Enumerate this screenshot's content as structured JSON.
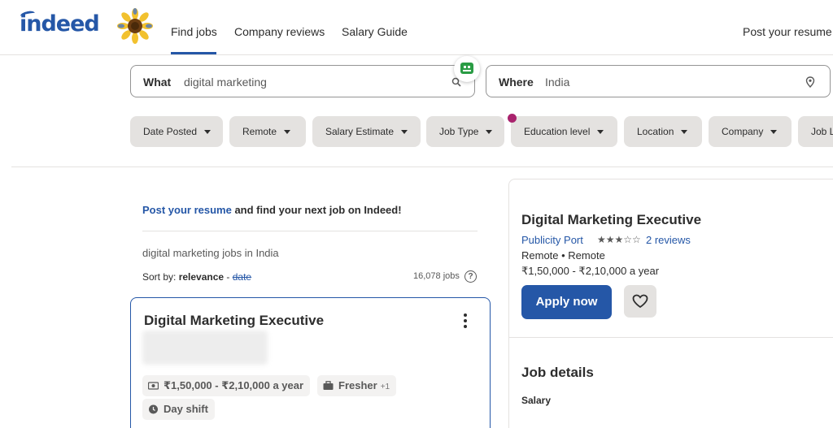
{
  "header": {
    "logo": "indeed",
    "nav": {
      "find_jobs": "Find jobs",
      "company_reviews": "Company reviews",
      "salary_guide": "Salary Guide",
      "post_resume": "Post your resume"
    },
    "active_tab": "Find jobs"
  },
  "search": {
    "what_label": "What",
    "what_value": "digital marketing",
    "where_label": "Where",
    "where_value": "India"
  },
  "filters": [
    "Date Posted",
    "Remote",
    "Salary Estimate",
    "Job Type",
    "Education level",
    "Location",
    "Company",
    "Job L"
  ],
  "results": {
    "promo_link": "Post your resume",
    "promo_text": " and find your next job on Indeed!",
    "heading": "digital marketing jobs in India",
    "sort_prefix": "Sort by: ",
    "sort_relevance": "relevance",
    "sort_separator": " - ",
    "sort_date": "date",
    "job_count": "16,078 jobs"
  },
  "job_card": {
    "title": "Digital Marketing Executive",
    "tags": {
      "salary": "₹1,50,000 - ₹2,10,000 a year",
      "fresher": "Fresher",
      "fresher_extra": "+1",
      "shift": "Day shift"
    }
  },
  "detail": {
    "title": "Digital Marketing Executive",
    "company": "Publicity Port",
    "rating": 3,
    "rating_stars": "★★★☆☆",
    "reviews": "2 reviews",
    "location": "Remote  •  Remote",
    "salary": "₹1,50,000 - ₹2,10,000 a year",
    "apply_label": "Apply now",
    "section_heading": "Job details",
    "sub_heading": "Salary"
  },
  "colors": {
    "brand": "#2557a7",
    "chip_bg": "#e4e2e0",
    "notification_dot": "#a9236d",
    "robot_badge": "#2a9c44"
  }
}
